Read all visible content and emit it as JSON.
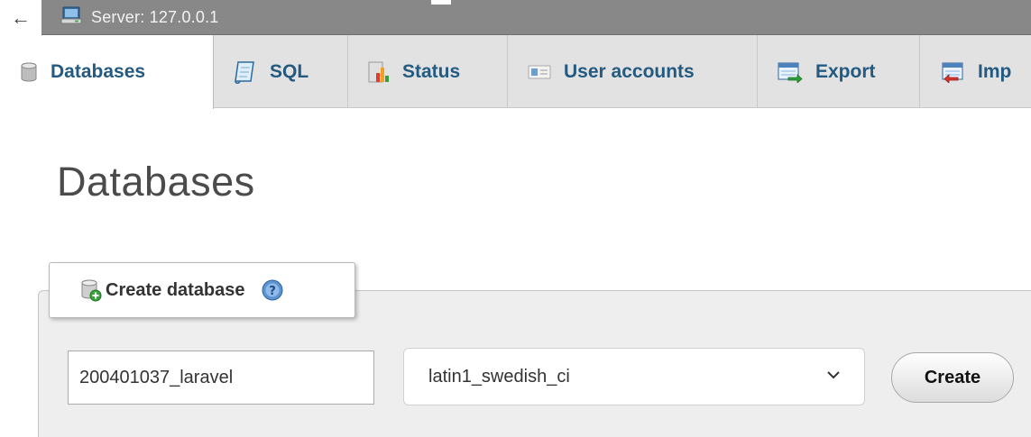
{
  "breadcrumb": {
    "back_symbol": "←",
    "server_icon": "server-icon",
    "server_label": "Server: 127.0.0.1"
  },
  "tabs": [
    {
      "label": "Databases",
      "icon": "database-icon",
      "active": true
    },
    {
      "label": "SQL",
      "icon": "sql-scroll-icon",
      "active": false
    },
    {
      "label": "Status",
      "icon": "status-chart-icon",
      "active": false
    },
    {
      "label": "User accounts",
      "icon": "user-card-icon",
      "active": false
    },
    {
      "label": "Export",
      "icon": "export-icon",
      "active": false
    },
    {
      "label": "Imp",
      "icon": "import-icon",
      "active": false
    }
  ],
  "page_title": "Databases",
  "create_database": {
    "legend": "Create database",
    "help_icon": "help-icon",
    "name_value": "200401037_laravel",
    "collation_selected": "latin1_swedish_ci",
    "create_label": "Create"
  },
  "colors": {
    "topbar": "#888888",
    "tab_background": "#e2e2e2",
    "tab_text": "#235a81",
    "fieldset_background": "#eeeeee"
  }
}
